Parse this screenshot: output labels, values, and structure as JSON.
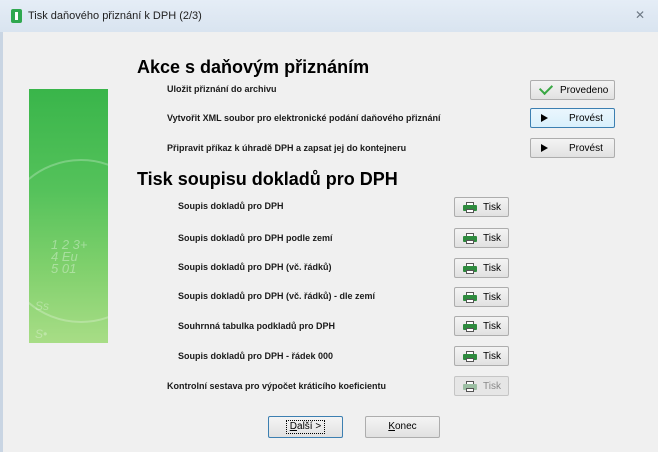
{
  "window": {
    "title": "Tisk daňového přiznání k DPH (2/3)",
    "close_label": "✕"
  },
  "side_image": {
    "deco_lines": [
      "1 2 3+",
      "4 Eu",
      "5 01"
    ],
    "deco_lines2": [
      "Ss",
      "S•"
    ]
  },
  "section1": {
    "heading": "Akce s daňovým přiznáním",
    "rows": [
      {
        "label": "Uložit přiznání do archivu",
        "button": "Provedeno",
        "icon": "check-icon"
      },
      {
        "label": "Vytvořit XML soubor pro elektronické podání daňového přiznání",
        "button": "Provést",
        "icon": "play-icon"
      },
      {
        "label": "Připravit příkaz k úhradě DPH a zapsat jej do kontejneru",
        "button": "Provést",
        "icon": "play-icon"
      }
    ]
  },
  "section2": {
    "heading": "Tisk soupisu dokladů pro DPH",
    "button_label": "Tisk",
    "rows": [
      {
        "label": "Soupis dokladů pro DPH"
      },
      {
        "label": "Soupis dokladů pro DPH podle zemí"
      },
      {
        "label": "Soupis dokladů pro DPH (vč. řádků)"
      },
      {
        "label": "Soupis dokladů pro DPH (vč. řádků) - dle zemí"
      },
      {
        "label": "Souhrnná tabulka podkladů pro DPH"
      },
      {
        "label": "Soupis dokladů pro DPH - řádek 000"
      },
      {
        "label": "Kontrolní sestava pro výpočet kráticího koeficientu"
      }
    ]
  },
  "footer": {
    "next_label_u": "D",
    "next_label_rest": "alší >",
    "end_label_u": "K",
    "end_label_rest": "onec"
  },
  "colors": {
    "accent_green": "#39b54a",
    "check_green": "#3aa845",
    "focus_blue": "#3c7fb1"
  }
}
